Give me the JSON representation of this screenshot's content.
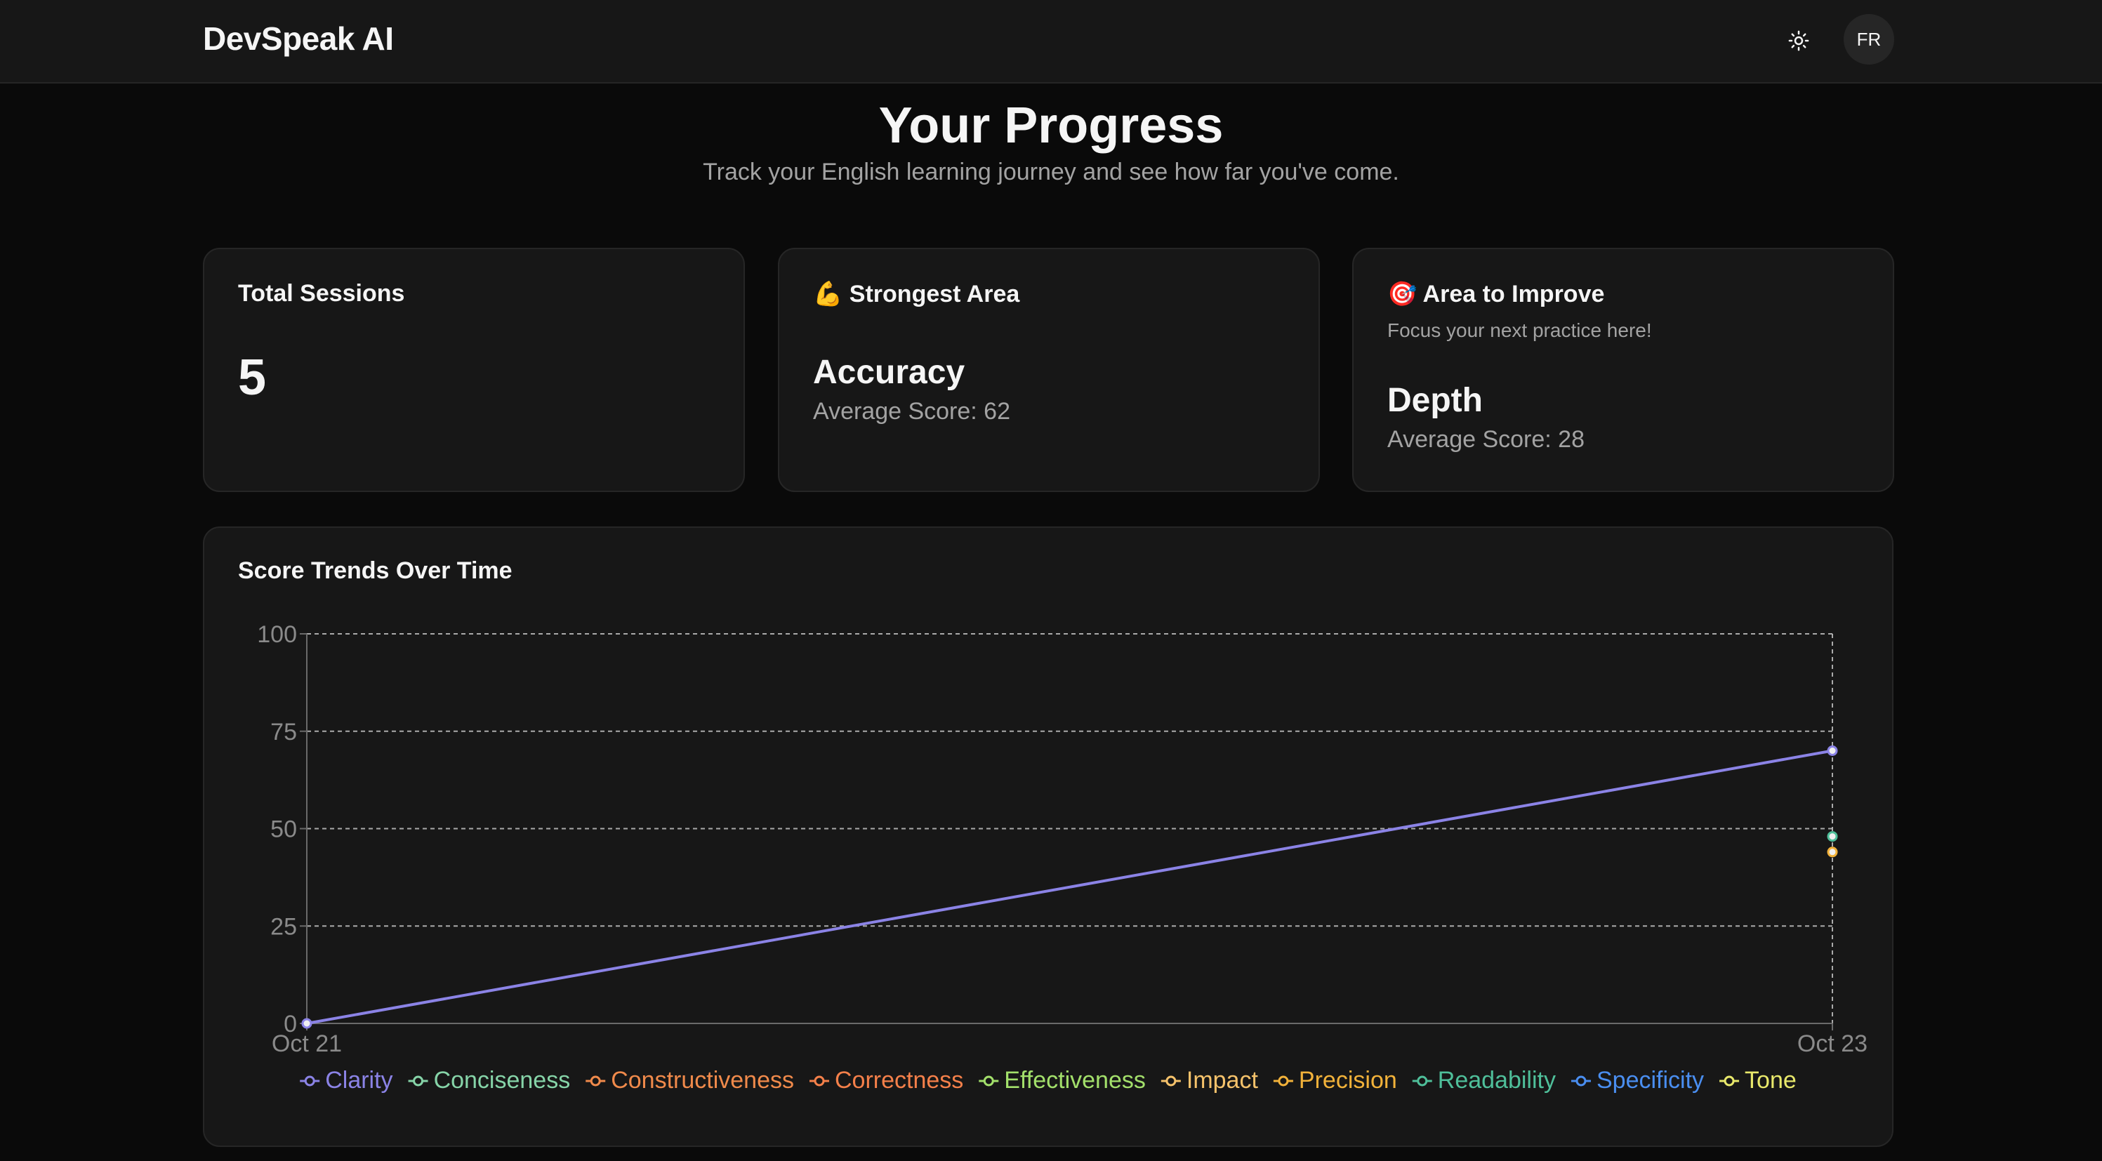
{
  "header": {
    "brand": "DevSpeak AI",
    "theme_icon": "sun-icon",
    "avatar_initials": "FR"
  },
  "page": {
    "title": "Your Progress",
    "subtitle": "Track your English learning journey and see how far you've come."
  },
  "cards": {
    "total_sessions": {
      "title": "Total Sessions",
      "value": "5"
    },
    "strongest": {
      "emoji": "💪",
      "title": "Strongest Area",
      "area": "Accuracy",
      "score": "Average Score: 62"
    },
    "improve": {
      "emoji": "🎯",
      "title": "Area to Improve",
      "desc": "Focus your next practice here!",
      "area": "Depth",
      "score": "Average Score: 28"
    }
  },
  "chart_data": {
    "type": "line",
    "title": "Score Trends Over Time",
    "x": [
      "Oct 21",
      "Oct 23"
    ],
    "ylim": [
      0,
      100
    ],
    "yticks": [
      0,
      25,
      50,
      75,
      100
    ],
    "grid": true,
    "legend_position": "bottom",
    "series": [
      {
        "name": "Clarity",
        "color": "#8b83e6",
        "values": [
          0,
          70
        ]
      },
      {
        "name": "Conciseness",
        "color": "#86d4a8",
        "values": [
          null,
          null
        ]
      },
      {
        "name": "Constructiveness",
        "color": "#f08a4b",
        "values": [
          null,
          null
        ]
      },
      {
        "name": "Correctness",
        "color": "#f5804a",
        "values": [
          null,
          null
        ]
      },
      {
        "name": "Effectiveness",
        "color": "#a3e06b",
        "values": [
          null,
          null
        ]
      },
      {
        "name": "Impact",
        "color": "#f5c26b",
        "values": [
          null,
          null
        ]
      },
      {
        "name": "Precision",
        "color": "#f2b23a",
        "values": [
          null,
          44
        ]
      },
      {
        "name": "Readability",
        "color": "#4fbf9a",
        "values": [
          null,
          48
        ]
      },
      {
        "name": "Specificity",
        "color": "#4a8ef0",
        "values": [
          null,
          null
        ]
      },
      {
        "name": "Tone",
        "color": "#e8e86b",
        "values": [
          null,
          null
        ]
      }
    ]
  }
}
